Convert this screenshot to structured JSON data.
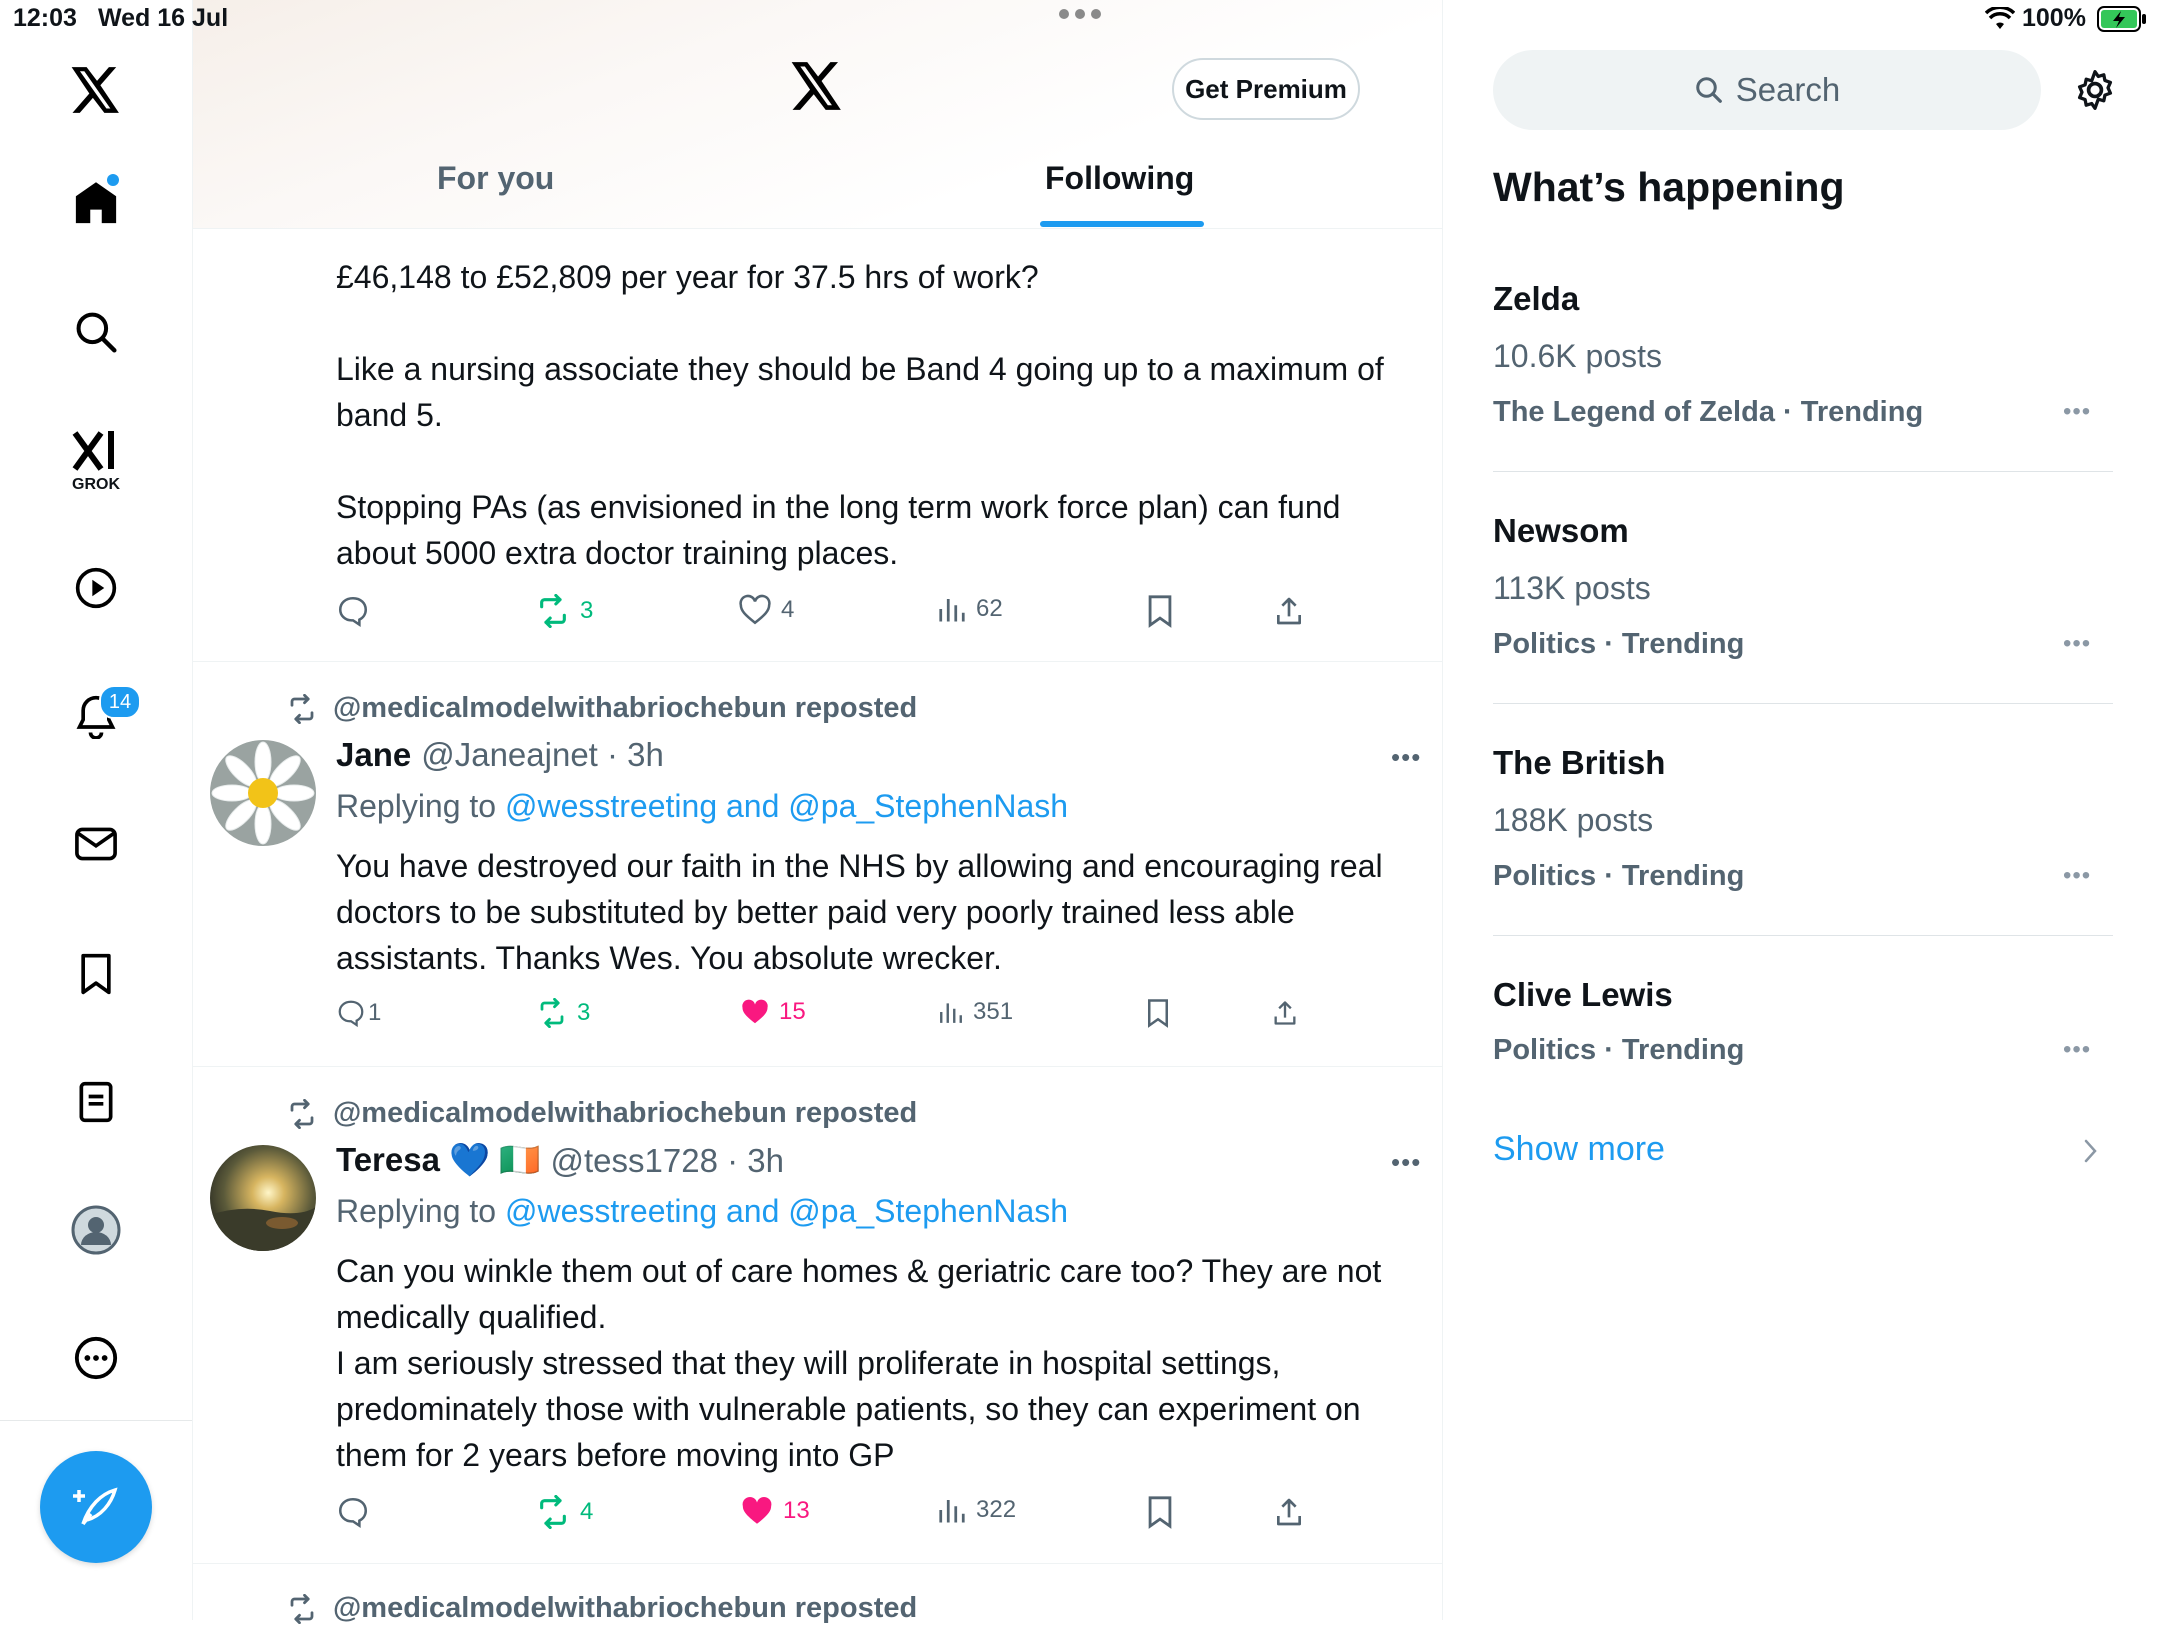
{
  "status_bar": {
    "time": "12:03",
    "date": "Wed 16 Jul",
    "battery": "100%"
  },
  "nav": {
    "grok_label": "GROK",
    "notifications_badge": "14",
    "items": [
      "home-icon",
      "search-icon",
      "grok-icon",
      "video-icon",
      "notifications-icon",
      "messages-icon",
      "bookmarks-icon",
      "lists-icon",
      "profile-icon",
      "more-icon"
    ],
    "compose": "compose-post-icon"
  },
  "header": {
    "premium_label": "Get Premium",
    "tabs": [
      {
        "label": "For you"
      },
      {
        "label": "Following",
        "active": true
      }
    ]
  },
  "posts": [
    {
      "text": "£46,148 to £52,809 per year for 37.5 hrs of work?\n\nLike a nursing associate they should be Band 4 going up to a maximum of band 5.\n\nStopping PAs (as envisioned in the long term work force plan) can fund about 5000 extra doctor training places.",
      "replies": "",
      "reposts": "3",
      "likes": "4",
      "views": "62"
    },
    {
      "repost_by": "@medicalmodelwithabriochebun reposted",
      "name": "Jane",
      "handle": "@Janeajnet · 3h",
      "replying_prefix": "Replying to ",
      "replying_to": "@wesstreeting and @pa_StephenNash",
      "text": "You have destroyed our faith in the NHS by allowing and encouraging real doctors to be substituted by better paid very poorly trained less able assistants. Thanks Wes. You absolute wrecker.",
      "replies": "1",
      "reposts": "3",
      "likes": "15",
      "views": "351"
    },
    {
      "repost_by": "@medicalmodelwithabriochebun reposted",
      "name": "Teresa 💙 🇮🇪",
      "handle": "@tess1728 · 3h",
      "replying_prefix": "Replying to ",
      "replying_to": "@wesstreeting and @pa_StephenNash",
      "text": "Can you winkle them out of care homes & geriatric care too? They are not medically qualified.\nI am seriously stressed that they will proliferate in hospital settings, predominately those with vulnerable patients, so they can experiment on them for 2 years before moving into GP",
      "replies": "",
      "reposts": "4",
      "likes": "13",
      "views": "322"
    },
    {
      "repost_by": "@medicalmodelwithabriochebun reposted"
    }
  ],
  "sidebar": {
    "search_placeholder": "Search",
    "title": "What’s happening",
    "trends": [
      {
        "name": "Zelda",
        "count": "10.6K posts",
        "context": "The Legend of Zelda · Trending"
      },
      {
        "name": "Newsom",
        "count": "113K posts",
        "context": "Politics · Trending"
      },
      {
        "name": "The British",
        "count": "188K posts",
        "context": "Politics · Trending"
      },
      {
        "name": "Clive Lewis",
        "count": "",
        "context": "Politics · Trending"
      }
    ],
    "show_more": "Show more"
  },
  "colors": {
    "accent": "#1d9bf0",
    "repost": "#00ba7c",
    "like": "#f91880",
    "muted": "#536471"
  }
}
